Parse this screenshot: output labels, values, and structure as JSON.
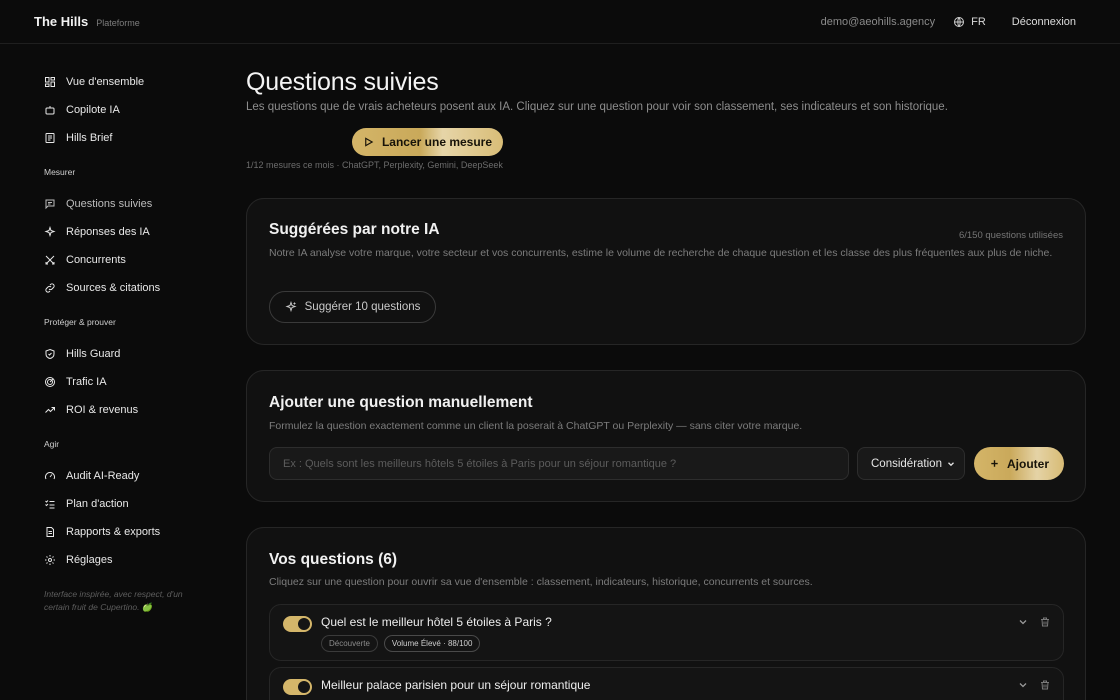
{
  "app": {
    "name": "The Hills",
    "subtitle": "Plateforme"
  },
  "header": {
    "email": "demo@aeohills.agency",
    "lang": "FR",
    "logout": "Déconnexion"
  },
  "sidebar": {
    "top_items": [
      {
        "label": "Vue d'ensemble",
        "icon": "dashboard-icon"
      },
      {
        "label": "Copilote IA",
        "icon": "robot-icon"
      },
      {
        "label": "Hills Brief",
        "icon": "newspaper-icon"
      }
    ],
    "sections": [
      {
        "title": "Mesurer",
        "items": [
          {
            "label": "Questions suivies",
            "icon": "chat-icon",
            "active": true
          },
          {
            "label": "Réponses des IA",
            "icon": "sparkle-icon"
          },
          {
            "label": "Concurrents",
            "icon": "swords-icon"
          },
          {
            "label": "Sources & citations",
            "icon": "link-icon"
          }
        ]
      },
      {
        "title": "Protéger & prouver",
        "items": [
          {
            "label": "Hills Guard",
            "icon": "shield-icon"
          },
          {
            "label": "Trafic IA",
            "icon": "radar-icon"
          },
          {
            "label": "ROI & revenus",
            "icon": "trend-up-icon"
          }
        ]
      },
      {
        "title": "Agir",
        "items": [
          {
            "label": "Audit AI-Ready",
            "icon": "gauge-icon"
          },
          {
            "label": "Plan d'action",
            "icon": "checklist-icon"
          },
          {
            "label": "Rapports & exports",
            "icon": "document-icon"
          },
          {
            "label": "Réglages",
            "icon": "gear-icon"
          }
        ]
      }
    ],
    "footnote": "Interface inspirée, avec respect, d'un certain fruit de Cupertino. 🍏"
  },
  "main": {
    "title": "Questions suivies",
    "subtitle": "Les questions que de vrais acheteurs posent aux IA. Cliquez sur une question pour voir son classement, ses indicateurs et son historique.",
    "run_button": "Lancer une mesure",
    "run_meta": "1/12 mesures ce mois · ChatGPT, Perplexity, Gemini, DeepSeek",
    "suggested": {
      "title": "Suggérées par notre IA",
      "usage": "6/150 questions utilisées",
      "description": "Notre IA analyse votre marque, votre secteur et vos concurrents, estime le volume de recherche de chaque question et les classe des plus fréquentes aux plus de niche.",
      "button": "Suggérer 10 questions"
    },
    "manual": {
      "title": "Ajouter une question manuellement",
      "description": "Formulez la question exactement comme un client la poserait à ChatGPT ou Perplexity — sans citer votre marque.",
      "placeholder": "Ex : Quels sont les meilleurs hôtels 5 étoiles à Paris pour un séjour romantique ?",
      "stage": "Considération",
      "add_button": "Ajouter"
    },
    "questions": {
      "title": "Vos questions (6)",
      "description": "Cliquez sur une question pour ouvrir sa vue d'ensemble : classement, indicateurs, historique, concurrents et sources.",
      "items": [
        {
          "text": "Quel est le meilleur hôtel 5 étoiles à Paris ?",
          "stage": "Découverte",
          "volume": "Volume Élevé · 88/100",
          "enabled": true
        },
        {
          "text": "Meilleur palace parisien pour un séjour romantique",
          "stage": "",
          "volume": "",
          "enabled": true
        }
      ]
    }
  },
  "colors": {
    "accent": "#d4b66a",
    "background": "#0b0b0b",
    "card": "#111111"
  }
}
